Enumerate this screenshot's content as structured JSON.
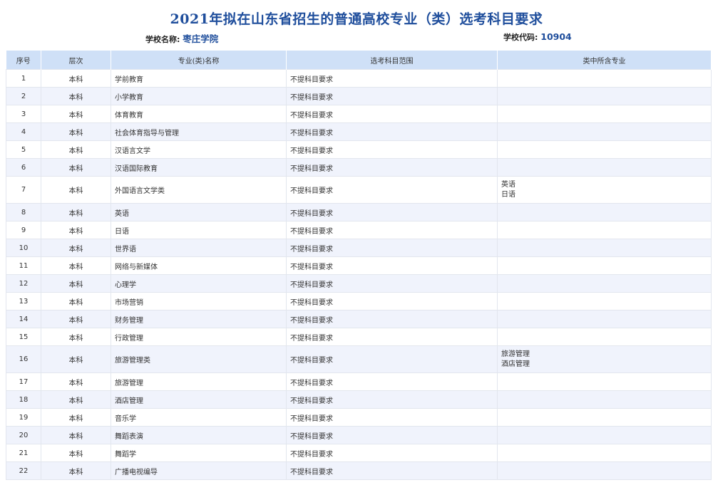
{
  "title": "2021年拟在山东省招生的普通高校专业（类）选考科目要求",
  "school": {
    "name_label": "学校名称:",
    "name": "枣庄学院",
    "code_label": "学校代码:",
    "code": "10904"
  },
  "table": {
    "headers": [
      "序号",
      "层次",
      "专业(类)名称",
      "选考科目范围",
      "类中所含专业"
    ],
    "rows": [
      {
        "no": "1",
        "level": "本科",
        "major": "学前教育",
        "req": "不提科目要求",
        "subs": []
      },
      {
        "no": "2",
        "level": "本科",
        "major": "小学教育",
        "req": "不提科目要求",
        "subs": []
      },
      {
        "no": "3",
        "level": "本科",
        "major": "体育教育",
        "req": "不提科目要求",
        "subs": []
      },
      {
        "no": "4",
        "level": "本科",
        "major": "社会体育指导与管理",
        "req": "不提科目要求",
        "subs": []
      },
      {
        "no": "5",
        "level": "本科",
        "major": "汉语言文学",
        "req": "不提科目要求",
        "subs": []
      },
      {
        "no": "6",
        "level": "本科",
        "major": "汉语国际教育",
        "req": "不提科目要求",
        "subs": []
      },
      {
        "no": "7",
        "level": "本科",
        "major": "外国语言文学类",
        "req": "不提科目要求",
        "subs": [
          "英语",
          "日语"
        ]
      },
      {
        "no": "8",
        "level": "本科",
        "major": "英语",
        "req": "不提科目要求",
        "subs": []
      },
      {
        "no": "9",
        "level": "本科",
        "major": "日语",
        "req": "不提科目要求",
        "subs": []
      },
      {
        "no": "10",
        "level": "本科",
        "major": "世界语",
        "req": "不提科目要求",
        "subs": []
      },
      {
        "no": "11",
        "level": "本科",
        "major": "网络与新媒体",
        "req": "不提科目要求",
        "subs": []
      },
      {
        "no": "12",
        "level": "本科",
        "major": "心理学",
        "req": "不提科目要求",
        "subs": []
      },
      {
        "no": "13",
        "level": "本科",
        "major": "市场营销",
        "req": "不提科目要求",
        "subs": []
      },
      {
        "no": "14",
        "level": "本科",
        "major": "财务管理",
        "req": "不提科目要求",
        "subs": []
      },
      {
        "no": "15",
        "level": "本科",
        "major": "行政管理",
        "req": "不提科目要求",
        "subs": []
      },
      {
        "no": "16",
        "level": "本科",
        "major": "旅游管理类",
        "req": "不提科目要求",
        "subs": [
          "旅游管理",
          "酒店管理"
        ]
      },
      {
        "no": "17",
        "level": "本科",
        "major": "旅游管理",
        "req": "不提科目要求",
        "subs": []
      },
      {
        "no": "18",
        "level": "本科",
        "major": "酒店管理",
        "req": "不提科目要求",
        "subs": []
      },
      {
        "no": "19",
        "level": "本科",
        "major": "音乐学",
        "req": "不提科目要求",
        "subs": []
      },
      {
        "no": "20",
        "level": "本科",
        "major": "舞蹈表演",
        "req": "不提科目要求",
        "subs": []
      },
      {
        "no": "21",
        "level": "本科",
        "major": "舞蹈学",
        "req": "不提科目要求",
        "subs": []
      },
      {
        "no": "22",
        "level": "本科",
        "major": "广播电视编导",
        "req": "不提科目要求",
        "subs": []
      }
    ]
  }
}
